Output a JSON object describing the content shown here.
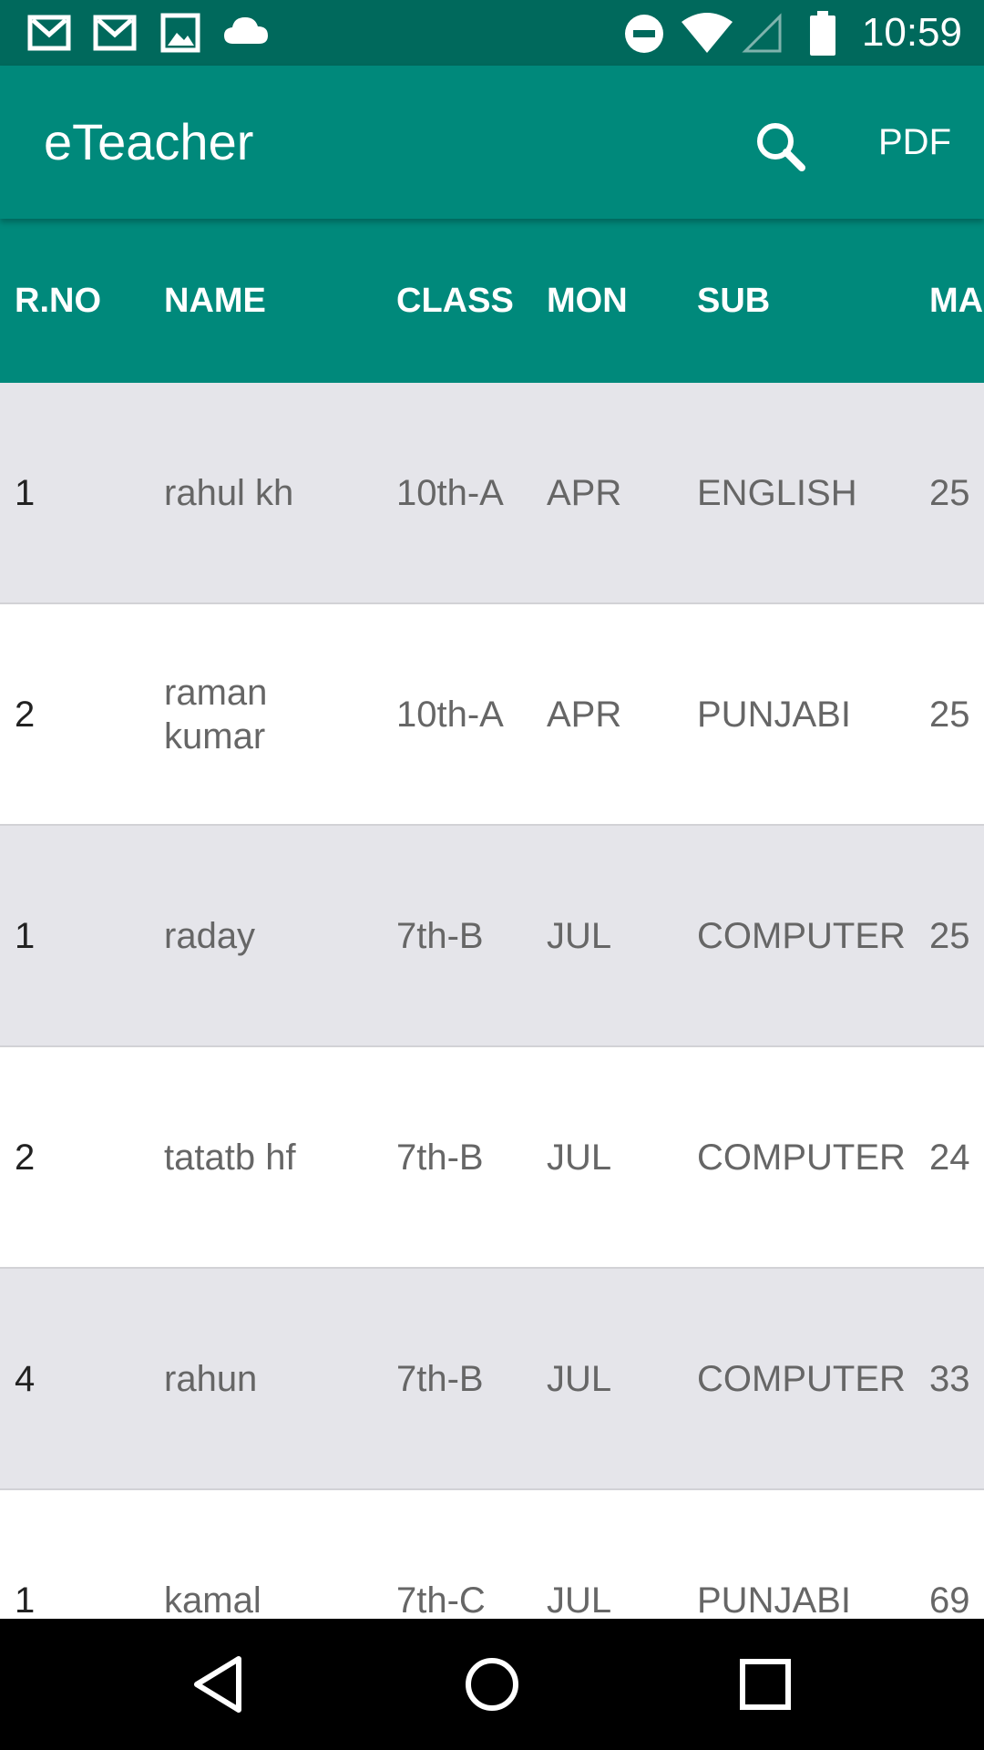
{
  "status_bar": {
    "time": "10:59",
    "left_icons": [
      "gmail-icon",
      "gmail-icon",
      "image-icon",
      "cloud-icon"
    ],
    "right_icons": [
      "do-not-disturb-icon",
      "wifi-icon",
      "signal-icon",
      "battery-icon"
    ]
  },
  "app_bar": {
    "title": "eTeacher",
    "search_icon": "search-icon",
    "pdf_label": "PDF",
    "color": "#00897b"
  },
  "table": {
    "headers": [
      "R.NO",
      "NAME",
      "CLASS",
      "MON",
      "SUB",
      "MA"
    ],
    "rows": [
      {
        "rno": "1",
        "name": "rahul kh",
        "class": "10th-A",
        "mon": "APR",
        "sub": "ENGLISH",
        "marks": "25"
      },
      {
        "rno": "2",
        "name": "raman kumar",
        "class": "10th-A",
        "mon": "APR",
        "sub": "PUNJABI",
        "marks": "25"
      },
      {
        "rno": "1",
        "name": "raday",
        "class": "7th-B",
        "mon": "JUL",
        "sub": "COMPUTER",
        "marks": "25"
      },
      {
        "rno": "2",
        "name": "tatatb hf",
        "class": "7th-B",
        "mon": "JUL",
        "sub": "COMPUTER",
        "marks": "24"
      },
      {
        "rno": "4",
        "name": "rahun",
        "class": "7th-B",
        "mon": "JUL",
        "sub": "COMPUTER",
        "marks": "33"
      },
      {
        "rno": "1",
        "name": "kamal",
        "class": "7th-C",
        "mon": "JUL",
        "sub": "PUNJABI",
        "marks": "69"
      }
    ]
  },
  "nav_bar": {
    "icons": [
      "back-icon",
      "home-icon",
      "recents-icon"
    ]
  },
  "colors": {
    "status_bar": "#00695c",
    "header": "#00897b",
    "row_alt": "#e5e5ea"
  }
}
